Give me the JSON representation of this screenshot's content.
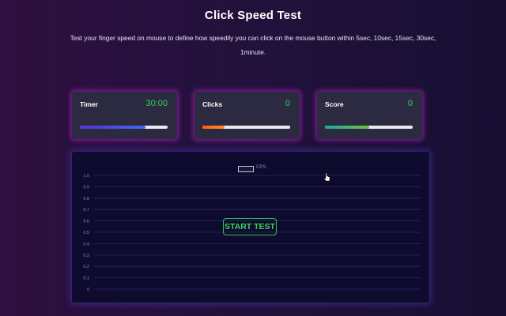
{
  "page": {
    "title": "Click Speed Test",
    "subtitle": "Test your finger speed on mouse to define how speedily you can click on the mouse button within 5sec, 10sec, 15sec, 30sec, 1minute."
  },
  "cards": {
    "timer": {
      "label": "Timer",
      "value": "30:00",
      "progress": 0.75
    },
    "clicks": {
      "label": "Clicks",
      "value": "0",
      "progress": 0.25
    },
    "score": {
      "label": "Score",
      "value": "0",
      "progress": 0.5
    }
  },
  "chart_data": {
    "type": "line",
    "legend": [
      "CPS"
    ],
    "series": [
      {
        "name": "CPS",
        "values": []
      }
    ],
    "y_ticks": [
      "1.0",
      "0.9",
      "0.8",
      "0.7",
      "0.6",
      "0.5",
      "0.4",
      "0.3",
      "0.2",
      "0.1",
      "0"
    ],
    "ylim": [
      0,
      1
    ],
    "grid": true,
    "legend_position": "top-center"
  },
  "actions": {
    "start_label": "START TEST"
  },
  "colors": {
    "accent_green": "#33d25a",
    "card_bg": "#2c2a40",
    "chart_bg": "#0f0b2e",
    "glow": "#c828dc"
  },
  "icons": {
    "cursor": "pointer-cursor-icon"
  }
}
